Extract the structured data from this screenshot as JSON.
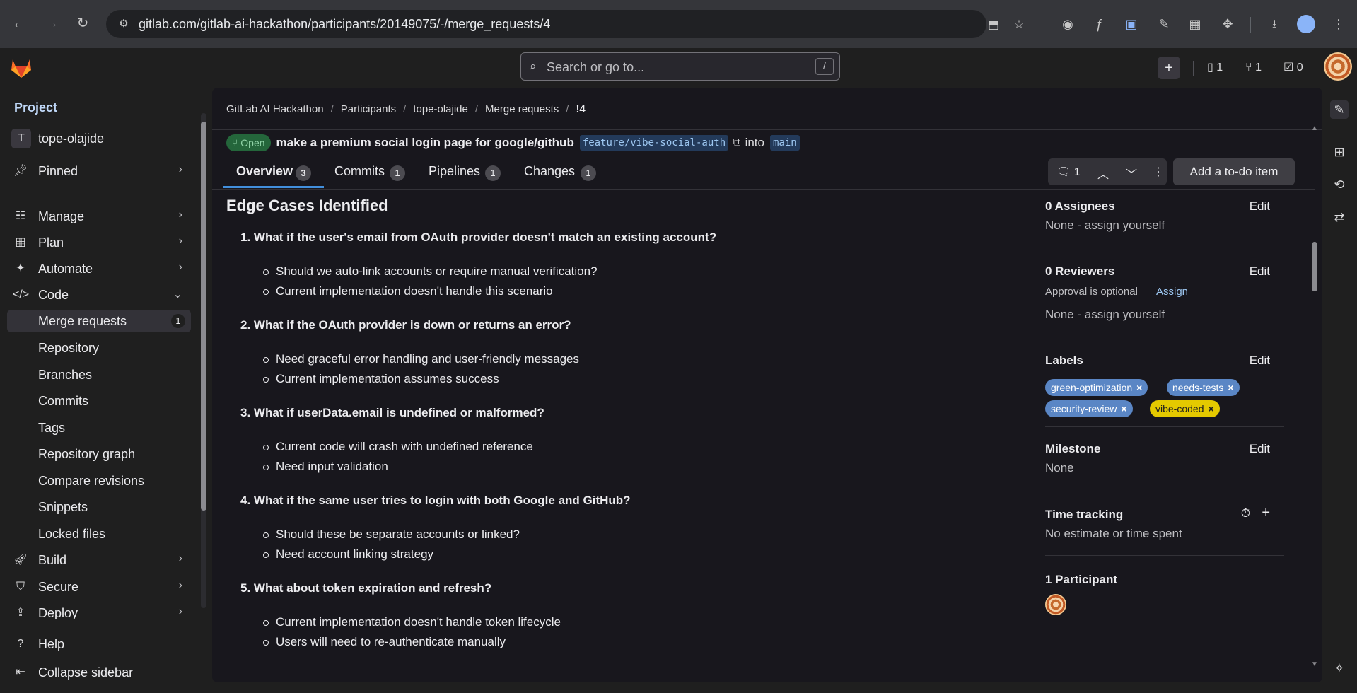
{
  "browser": {
    "url": "gitlab.com/gitlab-ai-hackathon/participants/20149075/-/merge_requests/4"
  },
  "topbar": {
    "search_placeholder": "Search or go to...",
    "search_shortcut": "/",
    "issues_count": "1",
    "mr_count": "1",
    "todo_count": "0"
  },
  "sidebar": {
    "heading": "Project",
    "project_initial": "T",
    "project_name": "tope-olajide",
    "pinned": "Pinned",
    "manage": "Manage",
    "plan": "Plan",
    "automate": "Automate",
    "code": "Code",
    "merge_requests": "Merge requests",
    "merge_requests_count": "1",
    "repository": "Repository",
    "branches": "Branches",
    "commits": "Commits",
    "tags": "Tags",
    "repository_graph": "Repository graph",
    "compare_revisions": "Compare revisions",
    "snippets": "Snippets",
    "locked_files": "Locked files",
    "build": "Build",
    "secure": "Secure",
    "deploy": "Deploy",
    "help": "Help",
    "collapse": "Collapse sidebar"
  },
  "breadcrumb": {
    "c1": "GitLab AI Hackathon",
    "c2": "Participants",
    "c3": "tope-olajide",
    "c4": "Merge requests",
    "c5": "!4"
  },
  "mr": {
    "status": "Open",
    "title": "make a premium social login page for google/github",
    "source_branch": "feature/vibe-social-auth",
    "into": "into",
    "target_branch": "main"
  },
  "tabs": {
    "overview": "Overview",
    "overview_count": "3",
    "commits": "Commits",
    "commits_count": "1",
    "pipelines": "Pipelines",
    "pipelines_count": "1",
    "changes": "Changes",
    "changes_count": "1"
  },
  "toolbar": {
    "threads_count": "1",
    "todo_button": "Add a to-do item"
  },
  "content": {
    "heading": "Edge Cases Identified",
    "q1": "1. What if the user's email from OAuth provider doesn't match an existing account?",
    "q1b1": "Should we auto-link accounts or require manual verification?",
    "q1b2": "Current implementation doesn't handle this scenario",
    "q2": "2. What if the OAuth provider is down or returns an error?",
    "q2b1": "Need graceful error handling and user-friendly messages",
    "q2b2": "Current implementation assumes success",
    "q3": "3. What if userData.email is undefined or malformed?",
    "q3b1": "Current code will crash with undefined reference",
    "q3b2": "Need input validation",
    "q4": "4. What if the same user tries to login with both Google and GitHub?",
    "q4b1": "Should these be separate accounts or linked?",
    "q4b2": "Need account linking strategy",
    "q5": "5. What about token expiration and refresh?",
    "q5b1": "Current implementation doesn't handle token lifecycle",
    "q5b2": "Users will need to re-authenticate manually"
  },
  "side": {
    "assignees_title": "0 Assignees",
    "assignees_value": "None - assign yourself",
    "reviewers_title": "0 Reviewers",
    "approval": "Approval is optional",
    "assign": "Assign",
    "reviewers_value": "None - assign yourself",
    "labels_title": "Labels",
    "label1": "green-optimization",
    "label2": "needs-tests",
    "label3": "security-review",
    "label4": "vibe-coded",
    "milestone_title": "Milestone",
    "milestone_value": "None",
    "time_title": "Time tracking",
    "time_value": "No estimate or time spent",
    "participants_title": "1 Participant",
    "edit": "Edit",
    "label_colors": {
      "blue": "#5a86c5",
      "yellow": "#e4c900"
    }
  }
}
